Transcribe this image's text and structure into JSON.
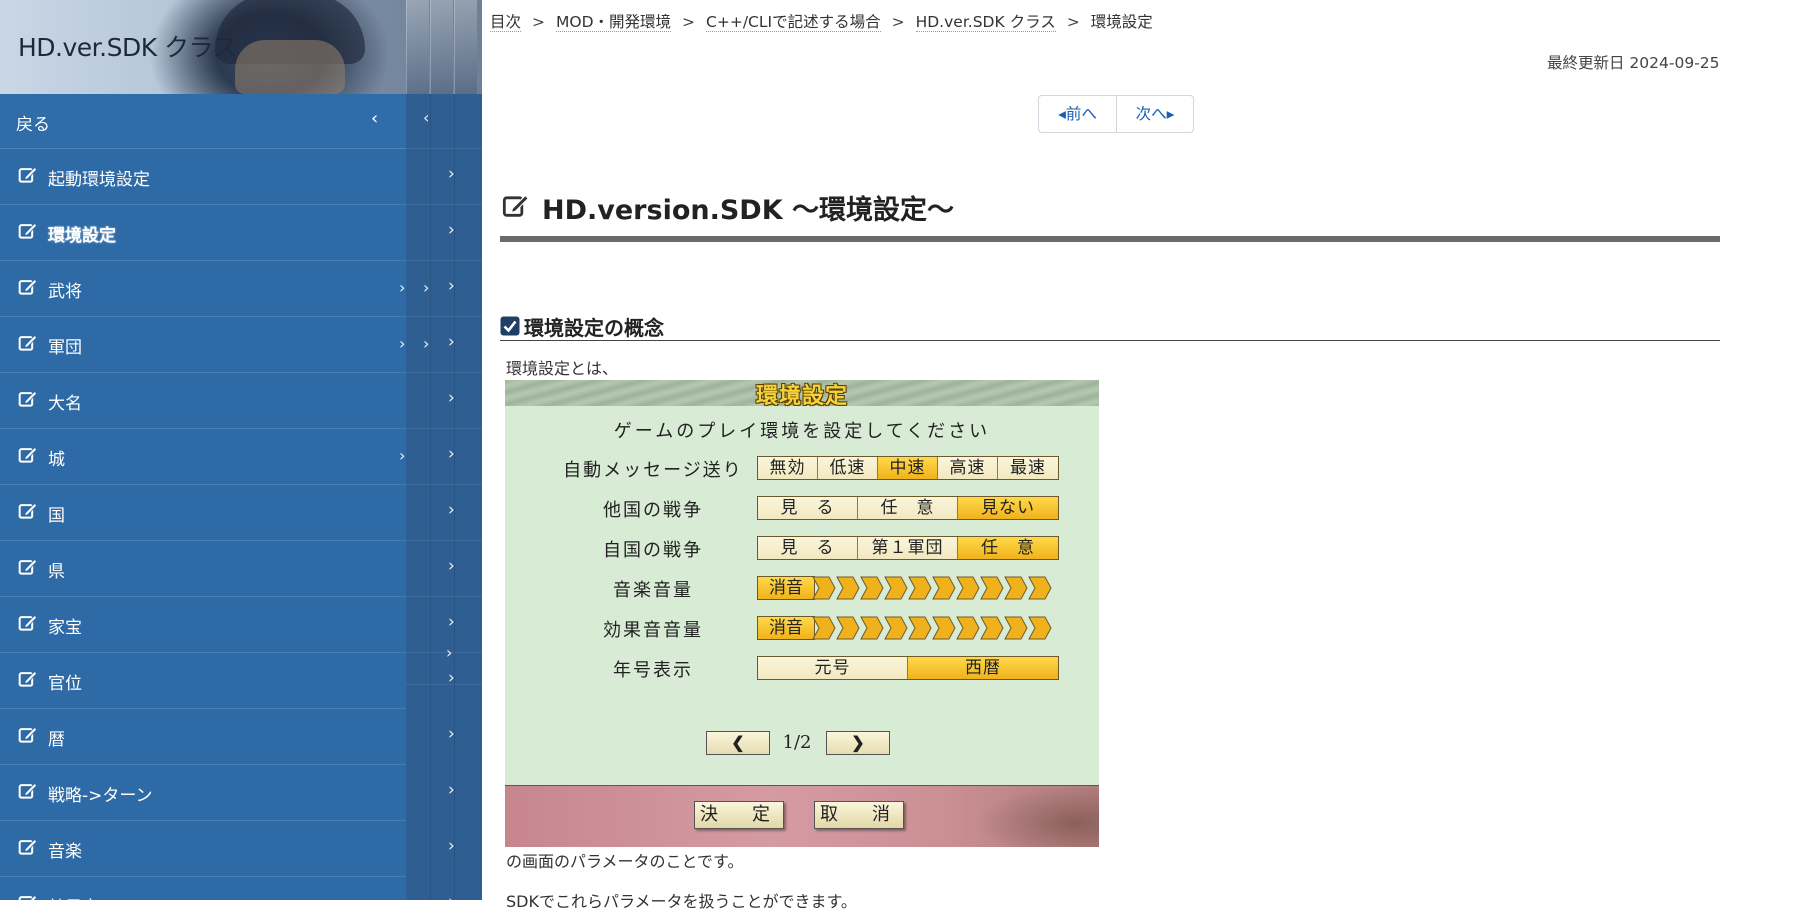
{
  "site": {
    "title": "HD.ver.SDK クラス"
  },
  "sidebar": {
    "back_label": "戻る",
    "items": [
      {
        "label": "起動環境設定"
      },
      {
        "label": "環境設定"
      },
      {
        "label": "武将"
      },
      {
        "label": "軍団"
      },
      {
        "label": "大名"
      },
      {
        "label": "城"
      },
      {
        "label": "国"
      },
      {
        "label": "県"
      },
      {
        "label": "家宝"
      },
      {
        "label": "官位"
      },
      {
        "label": "暦"
      },
      {
        "label": "戦略->ターン"
      },
      {
        "label": "音楽"
      },
      {
        "label": "効果音"
      }
    ],
    "active_item": "環境設定",
    "colors": {
      "panel": "#2d6aa6",
      "strip": "#2f5f92"
    }
  },
  "breadcrumb": [
    {
      "label": "目次"
    },
    {
      "label": "MOD・開発環境"
    },
    {
      "label": "C++/CLIで記述する場合"
    },
    {
      "label": "HD.ver.SDK クラス"
    },
    {
      "label": "環境設定"
    }
  ],
  "breadcrumb_separator": ">",
  "updated": "最終更新日 2024-09-25",
  "pager": {
    "prev": "前へ",
    "next": "次へ"
  },
  "page": {
    "title": "HD.version.SDK ～環境設定～",
    "section_heading": "環境設定の概念",
    "intro": "環境設定とは、",
    "after": "の画面のパラメータのことです。",
    "after2": "SDKでこれらパラメータを扱うことができます。"
  },
  "game_dialog": {
    "title": "環境設定",
    "subtitle": "ゲームのプレイ環境を設定してください",
    "rows": {
      "auto_message": {
        "label": "自動メッセージ送り",
        "options": [
          "無効",
          "低速",
          "中速",
          "高速",
          "最速"
        ],
        "selected": "中速"
      },
      "other_war": {
        "label": "他国の戦争",
        "options": [
          "見　る",
          "任　意",
          "見ない"
        ],
        "selected": "見ない"
      },
      "own_war": {
        "label": "自国の戦争",
        "options": [
          "見　る",
          "第１軍団",
          "任　意"
        ],
        "selected": "任　意"
      },
      "music_volume": {
        "label": "音楽音量",
        "mute_label": "消音",
        "level": 0
      },
      "sfx_volume": {
        "label": "効果音音量",
        "mute_label": "消音",
        "level": 0
      },
      "era_display": {
        "label": "年号表示",
        "options": [
          "元号",
          "西暦"
        ],
        "selected": "西暦"
      }
    },
    "page_indicator": "1/2",
    "ok_label": "決　定",
    "cancel_label": "取　消",
    "colors": {
      "body": "#d8ebd5",
      "selected": "#f0b21c",
      "title": "#f4d23a"
    }
  }
}
